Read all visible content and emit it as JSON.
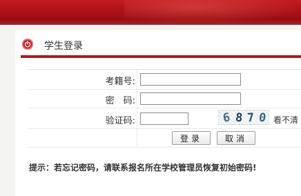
{
  "page": {
    "section_title": "学生登录"
  },
  "form": {
    "exam_id_label": "考籍号:",
    "exam_id_value": "",
    "password_label": "密　码:",
    "password_value": "",
    "captcha_label": "验证码:",
    "captcha_value": "",
    "captcha_chars": [
      "6",
      "8",
      "7",
      "0"
    ],
    "refresh_link": "看不清"
  },
  "buttons": {
    "login": "登录",
    "cancel": "取消"
  },
  "hint": "提示：若忘记密码，请联系报名所在学校管理员恢复初始密码!",
  "colors": {
    "brand_red": "#b3161b",
    "banner_red": "#c21b21"
  },
  "icons": {
    "title_icon": "power-icon"
  }
}
